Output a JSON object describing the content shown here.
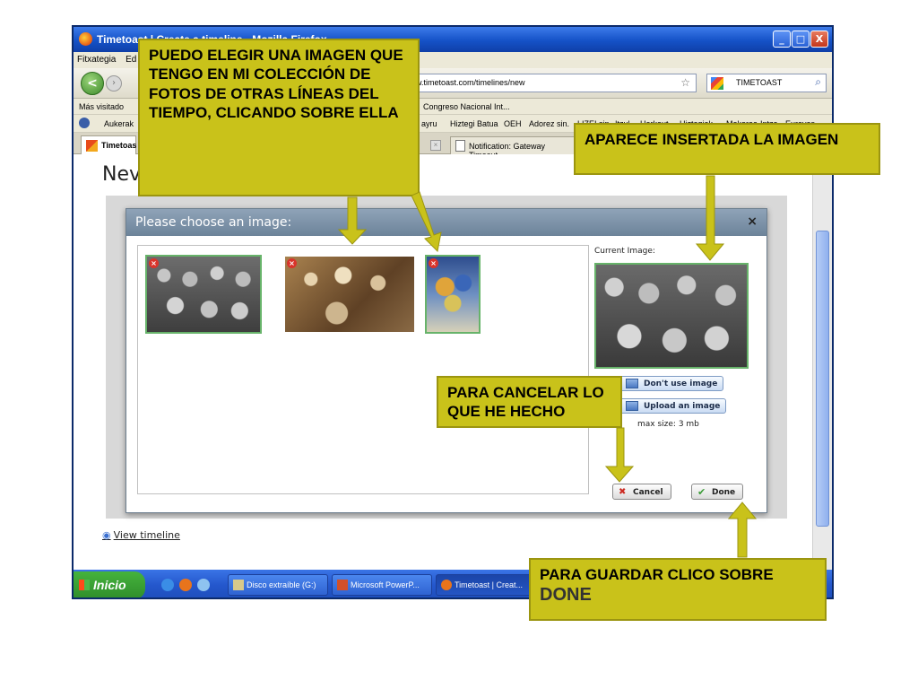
{
  "window": {
    "title": "Timetoast | Create a timeline - Mozilla Firefox"
  },
  "menubar": {
    "items": [
      "Fitxategia",
      "Ed"
    ]
  },
  "navbar": {
    "back_label": "<",
    "url": "w.timetoast.com/timelines/new",
    "search_value": "TIMETOAST"
  },
  "bookmarks": {
    "most_visited": "Más visitado",
    "congreso": "Congreso Nacional Int..."
  },
  "toolbar2": {
    "aukerak": "Aukerak",
    "items": [
      "ayru",
      "Hiztegi Batua",
      "OEH",
      "Adorez sin.",
      "LIZEI sin",
      "Itzul",
      "Harkaut",
      "Hiztegiak",
      "Mokoroa",
      "Intza",
      "Euroves"
    ]
  },
  "tabs": {
    "active": "Timetoas",
    "notification": "Notification: Gateway Timeout"
  },
  "page": {
    "heading": "Nev",
    "view_timeline": "View timeline"
  },
  "modal": {
    "title": "Please choose an image:",
    "close": "×",
    "current_label": "Current Image:",
    "dont_use": "Don't use image",
    "upload": "Upload an image",
    "max_size": "max size: 3 mb",
    "cancel": "Cancel",
    "done": "Done"
  },
  "taskbar": {
    "start": "Inicio",
    "items": [
      "Disco extraíble (G:)",
      "Microsoft PowerP...",
      "Timetoast | Creat..."
    ]
  },
  "callouts": {
    "choose": "PUEDO ELEGIR UNA IMAGEN QUE TENGO EN MI COLECCIÓN DE FOTOS DE OTRAS LÍNEAS DEL TIEMPO, CLICANDO SOBRE ELLA",
    "inserted": "APARECE INSERTADA LA IMAGEN",
    "cancel": "PARA CANCELAR LO QUE HE HECHO",
    "save_prefix": "PARA GUARDAR CLICO SOBRE",
    "save_done": "DONE"
  },
  "colors": {
    "callout": "#c9c21a",
    "titlebar": "#1552c7",
    "modal_header": "#7b91a7"
  }
}
